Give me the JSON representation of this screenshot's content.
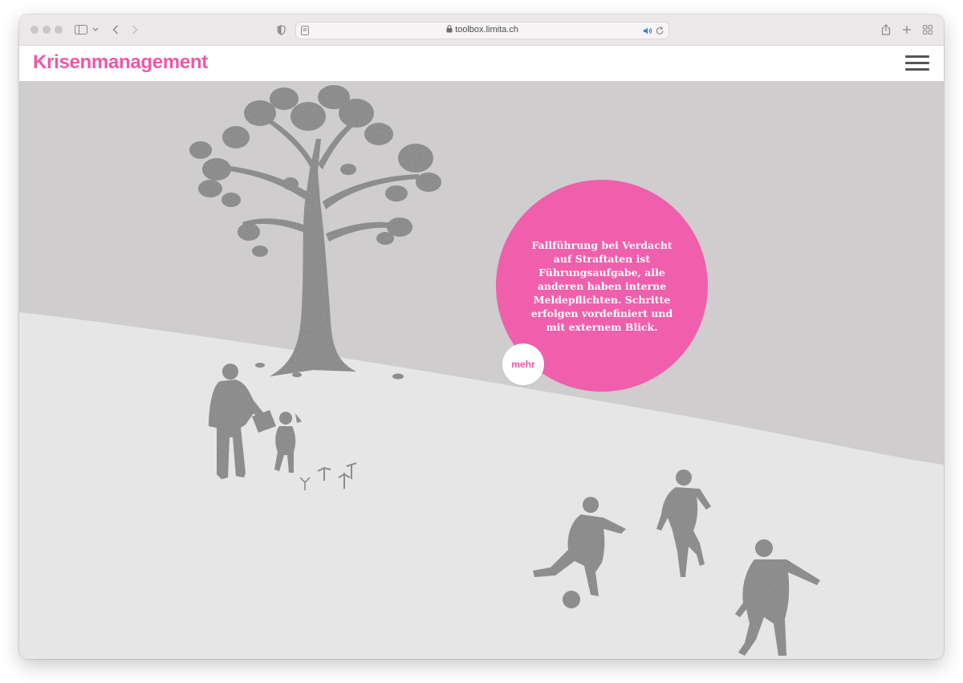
{
  "browser": {
    "url": "toolbox.limita.ch",
    "icons": [
      "window-traffic-lights",
      "sidebar-icon",
      "chevron-down-icon",
      "back-icon",
      "forward-icon",
      "shield-icon",
      "reader-icon",
      "lock-icon",
      "audio-icon",
      "reload-icon",
      "share-icon",
      "new-tab-icon",
      "tab-overview-icon"
    ]
  },
  "header": {
    "title": "Krisenmanagement",
    "menu_icon": "hamburger-menu-icon"
  },
  "hero": {
    "text": "Fallführung bei Verdacht auf Straftaten ist Führungsaufgabe, alle anderen haben interne Meldepflichten. Schritte erfolgen vordefiniert und mit externem Blick.",
    "more_label": "mehr"
  },
  "colors": {
    "accent": "#ee58a6",
    "bubble": "#ef5fac",
    "sky": "#cfcdce",
    "ground": "#e7e6e7",
    "silhouette": "#7c7b7c"
  }
}
